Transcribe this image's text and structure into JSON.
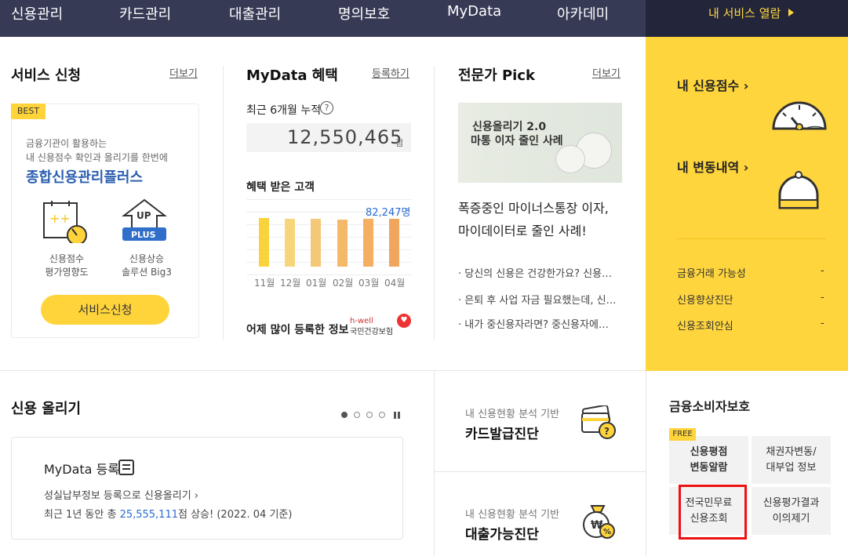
{
  "nav": {
    "items": [
      "신용관리",
      "카드관리",
      "대출관리",
      "명의보호",
      "MyData",
      "아카데미"
    ],
    "my_service": "내 서비스 열람"
  },
  "service": {
    "title": "서비스 신청",
    "more": "더보기",
    "badge": "BEST",
    "desc1": "금융기관이 활용하는",
    "desc2": "내 신용점수 확인과 올리기를 한번에",
    "name": "종합신용관리플러스",
    "feature1_line1": "신용점수",
    "feature1_line2": "평가영향도",
    "feature2_line1": "신용상승",
    "feature2_line2": "솔루션 Big3",
    "icon_up": "UP",
    "icon_plus": "PLUS",
    "button": "서비스신청"
  },
  "mydata": {
    "title": "MyData 혜택",
    "register": "등록하기",
    "cumulative_label": "최근 6개월 누적",
    "help": "?",
    "cumulative_value": "12,550,465",
    "cumulative_unit": "점",
    "customers_label": "혜택 받은 고객",
    "customers_value": "82,247명",
    "popular_label": "어제 많이 등록한 정보",
    "partner_brand": "h-well",
    "partner_name": "국민건강보험",
    "partner_mark": "♥"
  },
  "chart_data": {
    "type": "bar",
    "categories": [
      "11월",
      "12월",
      "01월",
      "02월",
      "03월",
      "04월"
    ],
    "values": [
      0.97,
      0.96,
      0.95,
      0.94,
      0.95,
      0.95
    ],
    "colors": [
      "#f9d33d",
      "#f7d57a",
      "#f5c878",
      "#f5b96a",
      "#f5af62",
      "#f1a660"
    ],
    "ylim": [
      0,
      1
    ]
  },
  "pick": {
    "title": "전문가 Pick",
    "more": "더보기",
    "img_line1": "신용올리기 2.0",
    "img_line2": "마통 이자 줄인 사례",
    "headline1": "폭증중인 마이너스통장 이자,",
    "headline2": "마이데이터로 줄인 사례!",
    "list": [
      "당신의 신용은 건강한가요? 신용…",
      "은퇴 후 사업 자금 필요했는데, 신…",
      "내가 중신용자라면? 중신용자에…"
    ]
  },
  "my_panel": {
    "score": "내 신용점수 ›",
    "changes": "내 변동내역 ›",
    "items": [
      "금융거래 가능성",
      "신용향상진단",
      "신용조회안심"
    ],
    "dash": "-"
  },
  "credit_up": {
    "title": "신용 올리기",
    "card_title": "MyData 등록",
    "line1": "성실납부정보 등록으로 신용올리기  ›",
    "line2_pre": "최근 1년 동안 총 ",
    "line2_num": "25,555,111",
    "line2_post": "점 상승! (2022. 04 기준)"
  },
  "diagnosis": {
    "card_sub": "내 신용현황 분석 기반",
    "card_title": "카드발급진단",
    "loan_sub": "내 신용현황 분석 기반",
    "loan_title": "대출가능진단",
    "card_icon_mark": "?",
    "loan_icon_mark1": "₩",
    "loan_icon_mark2": "%"
  },
  "protection": {
    "title": "금융소비자보호",
    "free": "FREE",
    "cells": [
      [
        "신용평점",
        "변동알람"
      ],
      [
        "채권자변동/",
        "대부업 정보"
      ],
      [
        "전국민무료",
        "신용조회"
      ],
      [
        "신용평가결과",
        "이의제기"
      ]
    ]
  }
}
